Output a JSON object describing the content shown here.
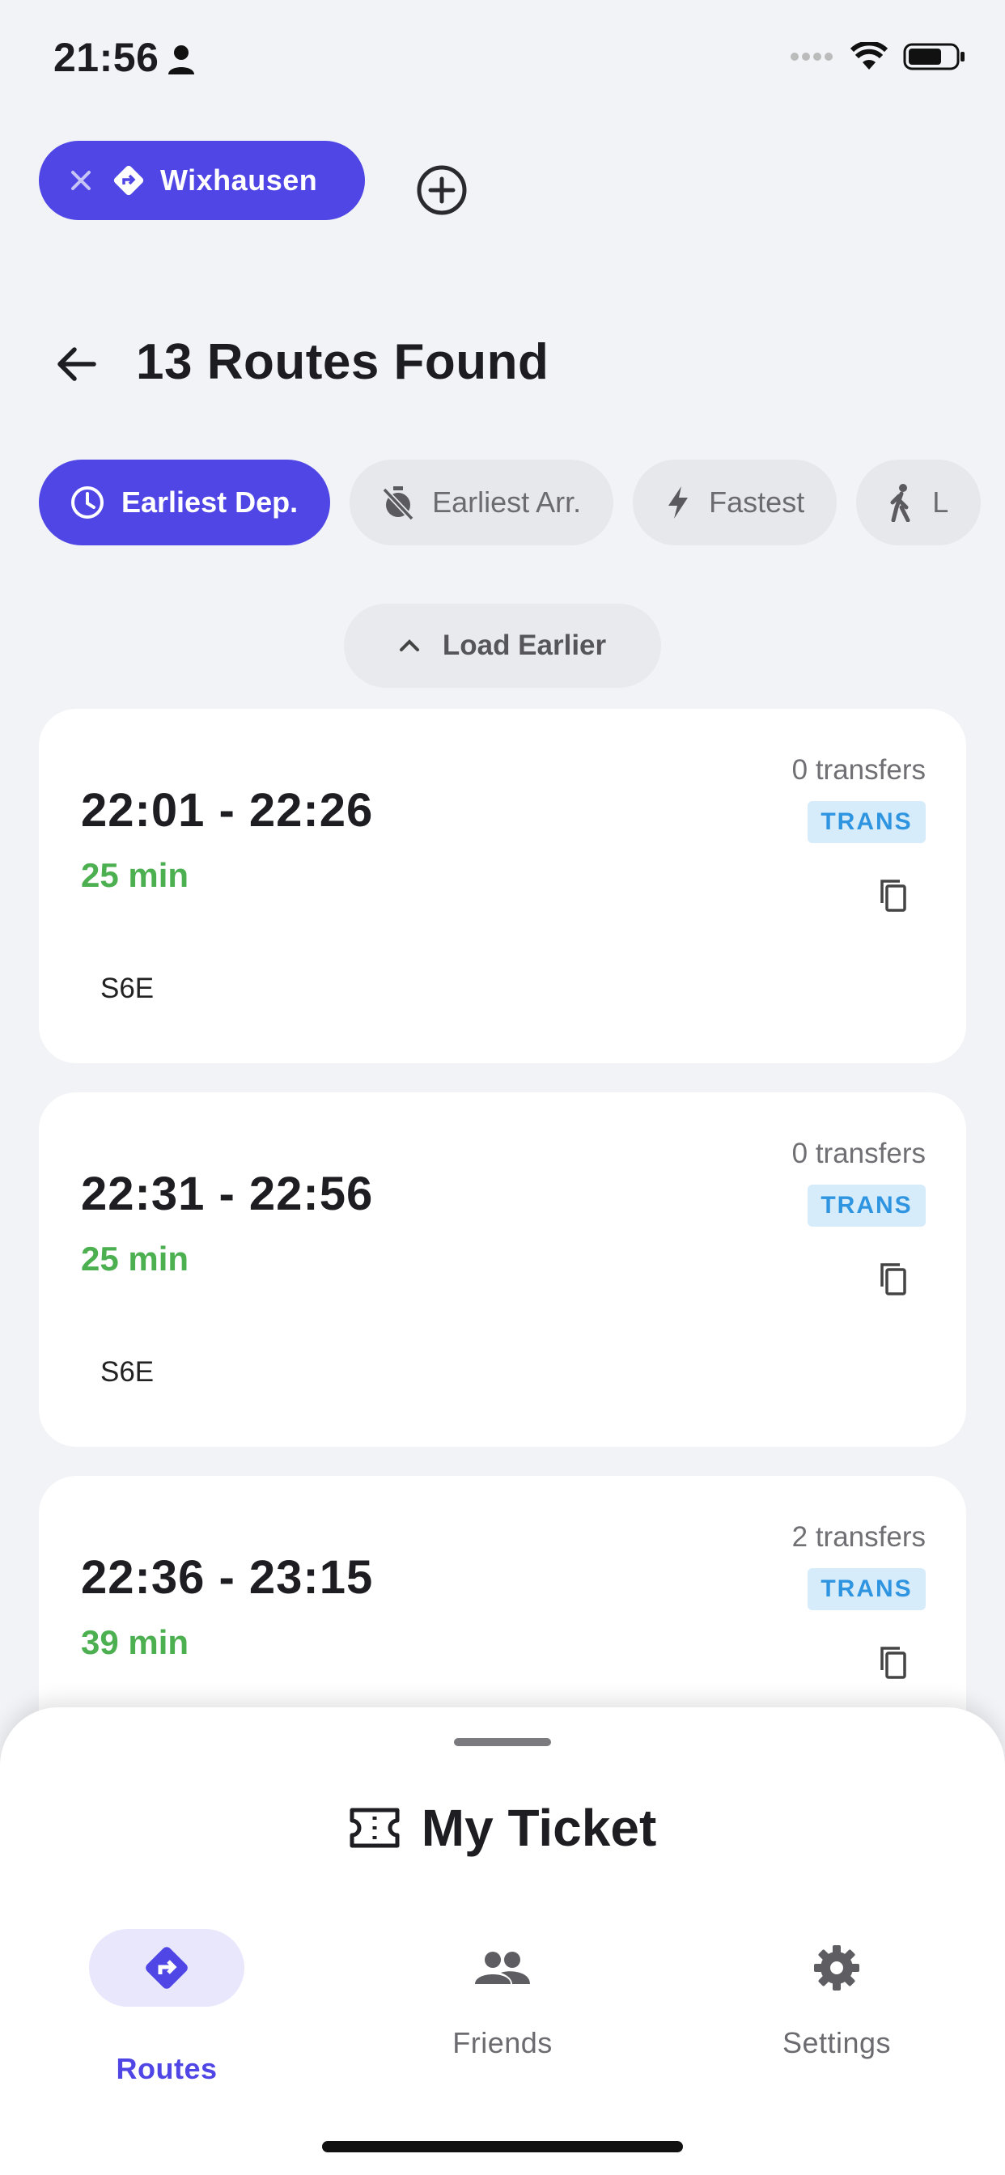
{
  "status_bar": {
    "time": "21:56"
  },
  "destination": {
    "label": "Wixhausen"
  },
  "header": {
    "title": "13 Routes Found"
  },
  "sort_options": [
    {
      "label": "Earliest Dep.",
      "icon": "clock-icon",
      "active": true
    },
    {
      "label": "Earliest Arr.",
      "icon": "timer-off-icon",
      "active": false
    },
    {
      "label": "Fastest",
      "icon": "bolt-icon",
      "active": false
    },
    {
      "label": "L",
      "icon": "walk-icon",
      "active": false
    }
  ],
  "load_earlier": {
    "label": "Load Earlier"
  },
  "routes": [
    {
      "times": "22:01 - 22:26",
      "duration": "25 min",
      "transfers": "0 transfers",
      "badge": "TRANS",
      "line": "S6E"
    },
    {
      "times": "22:31 - 22:56",
      "duration": "25 min",
      "transfers": "0 transfers",
      "badge": "TRANS",
      "line": "S6E"
    },
    {
      "times": "22:36 - 23:15",
      "duration": "39 min",
      "transfers": "2 transfers",
      "badge": "TRANS",
      "line": ""
    }
  ],
  "sheet": {
    "title": "My Ticket"
  },
  "nav": [
    {
      "label": "Routes",
      "icon": "route-icon",
      "active": true
    },
    {
      "label": "Friends",
      "icon": "people-icon",
      "active": false
    },
    {
      "label": "Settings",
      "icon": "gear-icon",
      "active": false
    }
  ],
  "colors": {
    "accent": "#4f46e5",
    "duration": "#4caf50",
    "badge_text": "#2f95e0",
    "badge_bg": "#d6ecfb"
  }
}
